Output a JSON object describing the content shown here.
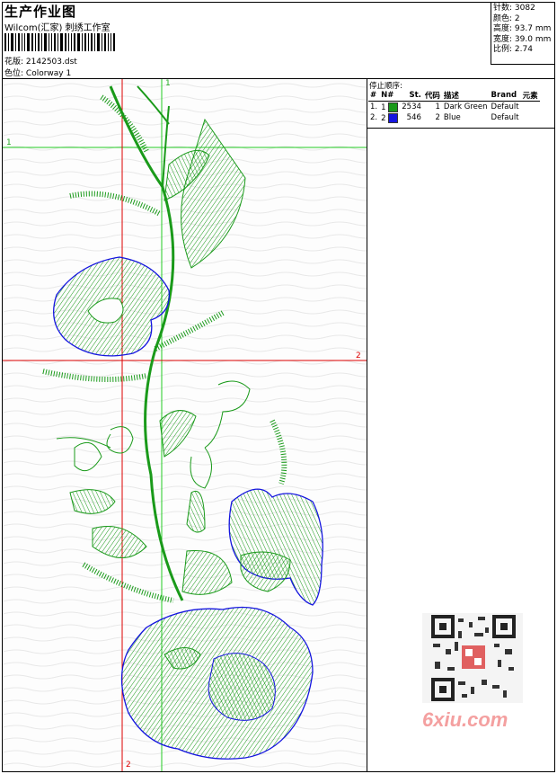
{
  "header": {
    "title": "生产作业图",
    "company": "Wilcom(汇家) 刺绣工作室",
    "design_label": "花版:",
    "design_value": "2142503.dst",
    "colorway_label": "色位:",
    "colorway_value": "Colorway 1"
  },
  "stats": {
    "stitches_label": "针数:",
    "stitches_value": "3082",
    "colors_label": "颜色:",
    "colors_value": "2",
    "height_label": "高度:",
    "height_value": "93.7 mm",
    "width_label": "宽度:",
    "width_value": "39.0 mm",
    "scale_label": "比例:",
    "scale_value": "2.74"
  },
  "legend": {
    "stop_sequence_label": "停止顺序:",
    "columns": [
      "#",
      "N#",
      "St.",
      "代码",
      "描述",
      "Brand",
      "元素"
    ],
    "rows": [
      {
        "index": "1.",
        "n": "1",
        "color": "#1a9a1a",
        "stitches": "2534",
        "code": "1",
        "description": "Dark Green",
        "brand": "Default"
      },
      {
        "index": "2.",
        "n": "2",
        "color": "#1515e0",
        "stitches": "546",
        "code": "2",
        "description": "Blue",
        "brand": "Default"
      }
    ]
  },
  "axes": {
    "green_label_top": "1",
    "green_label_left": "1",
    "red_label_right": "2",
    "red_label_bottom": "2"
  },
  "colors": {
    "thread_green": "#1a9a1a",
    "thread_blue": "#1515e0",
    "guide_green": "#22cc22",
    "guide_red": "#dd0000"
  },
  "watermark": "6xiu.com"
}
